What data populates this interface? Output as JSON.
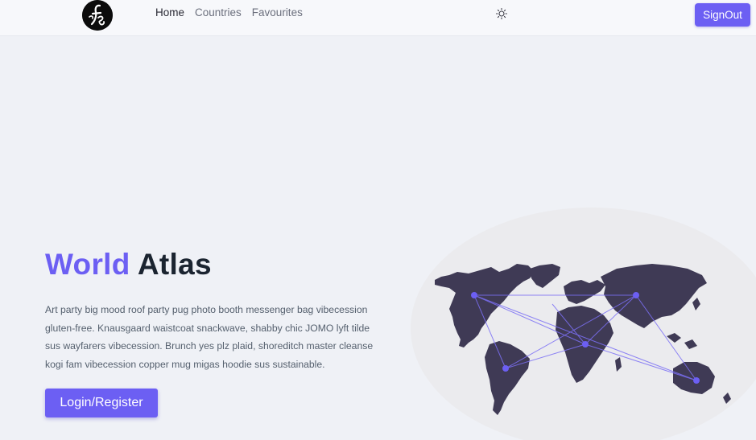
{
  "header": {
    "logo_icon": "fs-monogram-logo",
    "nav": [
      {
        "label": "Home",
        "active": true
      },
      {
        "label": "Countries",
        "active": false
      },
      {
        "label": "Favourites",
        "active": false
      }
    ],
    "theme_icon": "sun-icon",
    "signout_label": "SignOut"
  },
  "hero": {
    "title_part1": "World",
    "title_part2": "Atlas",
    "description": "Art party big mood roof party pug photo booth messenger bag vibecession gluten-free. Knausgaard waistcoat snackwave, shabby chic JOMO lyft tilde sus wayfarers vibecession. Brunch yes plz plaid, shoreditch master cleanse kogi fam vibecession copper mug migas hoodie sus sustainable.",
    "cta_label": "Login/Register",
    "illustration": "world-map-network-illustration"
  },
  "colors": {
    "accent": "#6c5ff3",
    "title_dark": "#1b2430",
    "map_land": "#3f3a55",
    "background": "#eff1f6"
  }
}
